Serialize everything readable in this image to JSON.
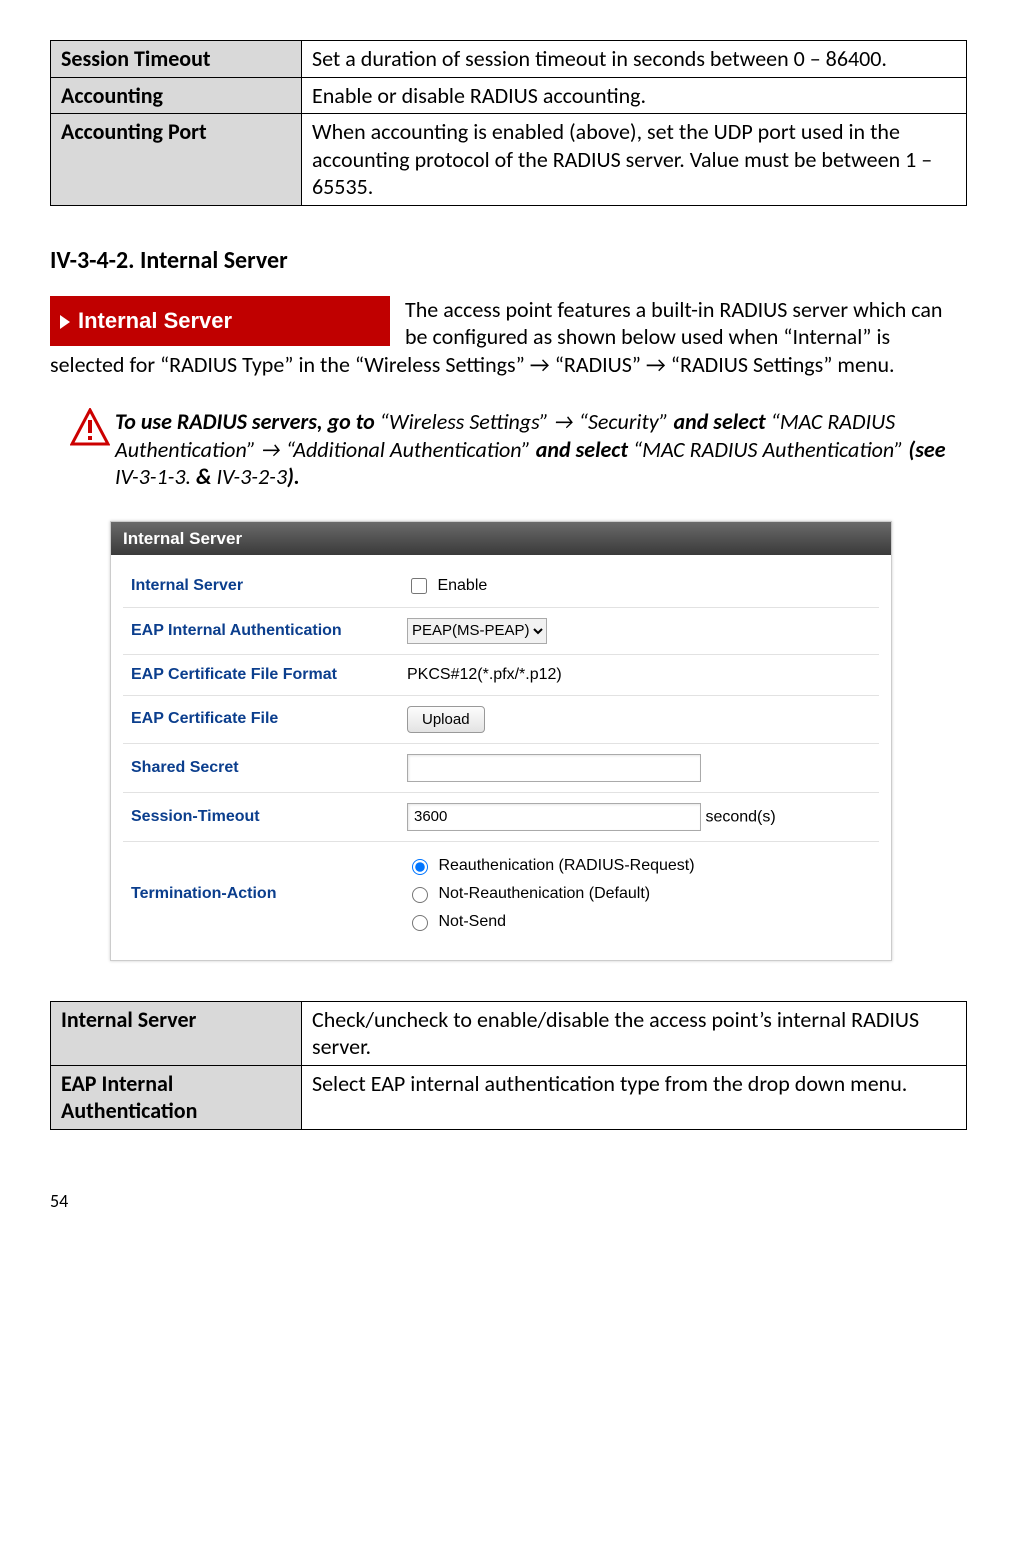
{
  "top_table": {
    "rows": [
      {
        "label": "Session Timeout",
        "desc": "Set a duration of session timeout in seconds between 0 – 86400."
      },
      {
        "label": "Accounting",
        "desc": "Enable or disable RADIUS accounting."
      },
      {
        "label": "Accounting Port",
        "desc": "When accounting is enabled (above), set the UDP port used in the accounting protocol of the RADIUS server. Value must be between 1 – 65535."
      }
    ]
  },
  "section_heading": "IV-3-4-2.    Internal Server",
  "breadcrumb": "Internal Server",
  "intro": "The access point features a built-in RADIUS server which can be configured as shown below used when “Internal” is selected for “RADIUS Type” in the “Wireless Settings” → “RADIUS” → “RADIUS Settings” menu.",
  "warning": {
    "pieces": [
      {
        "b": true,
        "t": "To use RADIUS servers, go to "
      },
      {
        "b": false,
        "t": "“Wireless Settings” → “Security” "
      },
      {
        "b": true,
        "t": "and select "
      },
      {
        "b": false,
        "t": "“MAC RADIUS Authentication” → “Additional Authentication” "
      },
      {
        "b": true,
        "t": "and select "
      },
      {
        "b": false,
        "t": "“MAC RADIUS Authentication” "
      },
      {
        "b": true,
        "t": "(see "
      },
      {
        "b": false,
        "t": "IV-3-1-3. "
      },
      {
        "b": true,
        "t": "& "
      },
      {
        "b": false,
        "t": "IV-3-2-3"
      },
      {
        "b": true,
        "t": ")."
      }
    ]
  },
  "screenshot": {
    "title": "Internal Server",
    "rows": {
      "internal_server_label": "Internal Server",
      "enable_label": "Enable",
      "eap_auth_label": "EAP Internal Authentication",
      "eap_auth_value": "PEAP(MS-PEAP)",
      "cert_format_label": "EAP Certificate File Format",
      "cert_format_value": "PKCS#12(*.pfx/*.p12)",
      "cert_file_label": "EAP Certificate File",
      "upload_btn": "Upload",
      "shared_secret_label": "Shared Secret",
      "shared_secret_value": "",
      "session_timeout_label": "Session-Timeout",
      "session_timeout_value": "3600",
      "seconds_suffix": "second(s)",
      "termination_label": "Termination-Action",
      "radio1": "Reauthenication (RADIUS-Request)",
      "radio2": "Not-Reauthenication (Default)",
      "radio3": "Not-Send"
    }
  },
  "bottom_table": {
    "rows": [
      {
        "label": "Internal Server",
        "desc": "Check/uncheck to enable/disable the access point’s internal RADIUS server."
      },
      {
        "label": "EAP Internal Authentication",
        "desc": "Select EAP internal authentication type from the drop down menu."
      }
    ]
  },
  "page_number": "54"
}
